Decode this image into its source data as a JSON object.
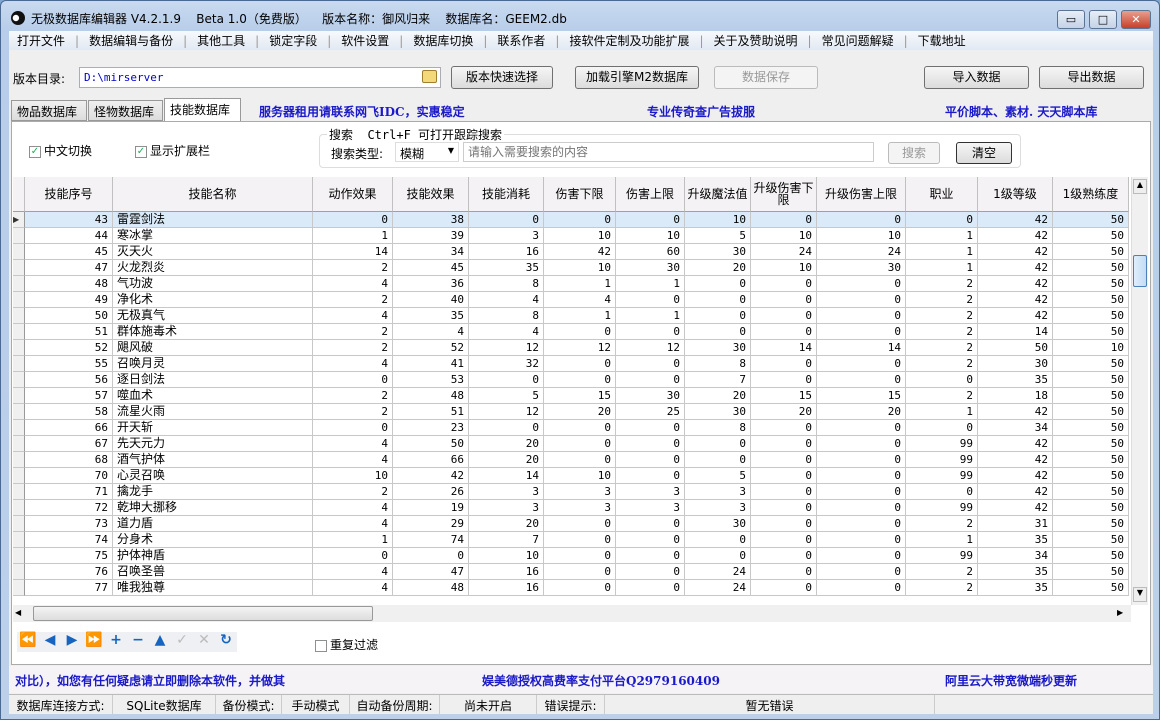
{
  "window": {
    "title": "无极数据库编辑器 V4.2.1.9    Beta 1.0（免费版）    版本名称：御风归来    数据库名：GEEM2.db",
    "min": "▭",
    "max": "□",
    "close": "✕"
  },
  "menu": [
    "打开文件",
    "数据编辑与备份",
    "其他工具",
    "锁定字段",
    "软件设置",
    "数据库切换",
    "联系作者",
    "接软件定制及功能扩展",
    "关于及赞助说明",
    "常见问题解疑",
    "下载地址"
  ],
  "toolbar": {
    "dir_label": "版本目录:",
    "dir_value": "D:\\mirserver",
    "quick_select": "版本快速选择",
    "load_m2": "加载引擎M2数据库",
    "save": "数据保存",
    "import": "导入数据",
    "export": "导出数据"
  },
  "tabs": [
    {
      "label": "物品数据库",
      "active": false
    },
    {
      "label": "怪物数据库",
      "active": false
    },
    {
      "label": "技能数据库",
      "active": true
    }
  ],
  "ads": {
    "top1": "服务器租用请联系网飞IDC，实惠稳定",
    "top2": "专业传奇查广告拔服",
    "top3": "平价脚本、素材. 天天脚本库",
    "bottom1": "对比），如您有任何疑虑请立即删除本软件，并做其",
    "bottom2": "娱美德授权高费率支付平台Q2979160409",
    "bottom3": "阿里云大带宽微端秒更新"
  },
  "options": {
    "chinese": "中文切换",
    "chinese_checked": true,
    "show_ext": "显示扩展栏",
    "show_ext_checked": true,
    "dup_filter": "重复过滤",
    "dup_filter_checked": false
  },
  "search": {
    "group_title": "搜索  Ctrl+F 可打开跟踪搜索",
    "type_label": "搜索类型:",
    "type_value": "模糊",
    "placeholder": "请输入需要搜索的内容",
    "search_btn": "搜索",
    "clear_btn": "清空"
  },
  "table": {
    "columns": [
      "技能序号",
      "技能名称",
      "动作效果",
      "技能效果",
      "技能消耗",
      "伤害下限",
      "伤害上限",
      "升级魔法值",
      "升级伤害下限",
      "升级伤害上限",
      "职业",
      "1级等级",
      "1级熟练度"
    ],
    "selected_row": 0,
    "rows": [
      [
        "43",
        "雷霆剑法",
        "0",
        "38",
        "0",
        "0",
        "0",
        "10",
        "0",
        "0",
        "0",
        "42",
        "50"
      ],
      [
        "44",
        "寒冰掌",
        "1",
        "39",
        "3",
        "10",
        "10",
        "5",
        "10",
        "10",
        "1",
        "42",
        "50"
      ],
      [
        "45",
        "灭天火",
        "14",
        "34",
        "16",
        "42",
        "60",
        "30",
        "24",
        "24",
        "1",
        "42",
        "50"
      ],
      [
        "47",
        "火龙烈炎",
        "2",
        "45",
        "35",
        "10",
        "30",
        "20",
        "10",
        "30",
        "1",
        "42",
        "50"
      ],
      [
        "48",
        "气功波",
        "4",
        "36",
        "8",
        "1",
        "1",
        "0",
        "0",
        "0",
        "2",
        "42",
        "50"
      ],
      [
        "49",
        "净化术",
        "2",
        "40",
        "4",
        "4",
        "0",
        "0",
        "0",
        "0",
        "2",
        "42",
        "50"
      ],
      [
        "50",
        "无极真气",
        "4",
        "35",
        "8",
        "1",
        "1",
        "0",
        "0",
        "0",
        "2",
        "42",
        "50"
      ],
      [
        "51",
        "群体施毒术",
        "2",
        "4",
        "4",
        "0",
        "0",
        "0",
        "0",
        "0",
        "2",
        "14",
        "50"
      ],
      [
        "52",
        "飓风破",
        "2",
        "52",
        "12",
        "12",
        "12",
        "30",
        "14",
        "14",
        "2",
        "50",
        "10"
      ],
      [
        "55",
        "召唤月灵",
        "4",
        "41",
        "32",
        "0",
        "0",
        "8",
        "0",
        "0",
        "2",
        "30",
        "50"
      ],
      [
        "56",
        "逐日剑法",
        "0",
        "53",
        "0",
        "0",
        "0",
        "7",
        "0",
        "0",
        "0",
        "35",
        "50"
      ],
      [
        "57",
        "噬血术",
        "2",
        "48",
        "5",
        "15",
        "30",
        "20",
        "15",
        "15",
        "2",
        "18",
        "50"
      ],
      [
        "58",
        "流星火雨",
        "2",
        "51",
        "12",
        "20",
        "25",
        "30",
        "20",
        "20",
        "1",
        "42",
        "50"
      ],
      [
        "66",
        "开天斩",
        "0",
        "23",
        "0",
        "0",
        "0",
        "8",
        "0",
        "0",
        "0",
        "34",
        "50"
      ],
      [
        "67",
        "先天元力",
        "4",
        "50",
        "20",
        "0",
        "0",
        "0",
        "0",
        "0",
        "99",
        "42",
        "50"
      ],
      [
        "68",
        "酒气护体",
        "4",
        "66",
        "20",
        "0",
        "0",
        "0",
        "0",
        "0",
        "99",
        "42",
        "50"
      ],
      [
        "70",
        "心灵召唤",
        "10",
        "42",
        "14",
        "10",
        "0",
        "5",
        "0",
        "0",
        "99",
        "42",
        "50"
      ],
      [
        "71",
        "擒龙手",
        "2",
        "26",
        "3",
        "3",
        "3",
        "3",
        "0",
        "0",
        "0",
        "42",
        "50"
      ],
      [
        "72",
        "乾坤大挪移",
        "4",
        "19",
        "3",
        "3",
        "3",
        "3",
        "0",
        "0",
        "99",
        "42",
        "50"
      ],
      [
        "73",
        "道力盾",
        "4",
        "29",
        "20",
        "0",
        "0",
        "30",
        "0",
        "0",
        "2",
        "31",
        "50"
      ],
      [
        "74",
        "分身术",
        "1",
        "74",
        "7",
        "0",
        "0",
        "0",
        "0",
        "0",
        "1",
        "35",
        "50"
      ],
      [
        "75",
        "护体神盾",
        "0",
        "0",
        "10",
        "0",
        "0",
        "0",
        "0",
        "0",
        "99",
        "34",
        "50"
      ],
      [
        "76",
        "召唤圣兽",
        "4",
        "47",
        "16",
        "0",
        "0",
        "24",
        "0",
        "0",
        "2",
        "35",
        "50"
      ],
      [
        "77",
        "唯我独尊",
        "4",
        "48",
        "16",
        "0",
        "0",
        "24",
        "0",
        "0",
        "2",
        "35",
        "50"
      ]
    ]
  },
  "nav_icons": [
    "first-icon",
    "prior-icon",
    "next-icon",
    "last-icon",
    "insert-icon",
    "delete-icon",
    "edit-icon",
    "post-icon",
    "cancel-icon",
    "refresh-icon"
  ],
  "status": {
    "conn_label": "数据库连接方式:",
    "conn_value": "SQLite数据库",
    "backup_label": "备份模式:",
    "backup_value": "手动模式",
    "auto_label": "自动备份周期:",
    "auto_value": "尚未开启",
    "err_label": "错误提示:",
    "err_value": "暂无错误"
  },
  "colors": {
    "ad_text": "#1a1ac8",
    "selected_row": "#dbeaf8",
    "nav_icon": "#1565c0"
  }
}
